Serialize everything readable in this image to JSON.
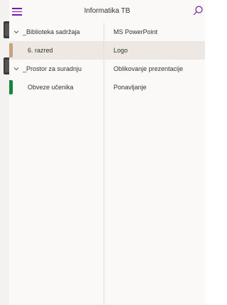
{
  "header": {
    "title": "Informatika TB",
    "menu_icon": "hamburger-icon",
    "search_icon": "search-icon"
  },
  "sections": {
    "groups": [
      {
        "label": "_Biblioteka sadržaja",
        "expanded": true,
        "items": [
          {
            "label": "6. razred",
            "color": "#c8a27a",
            "selected": true
          }
        ]
      },
      {
        "label": "_Prostor za suradnju",
        "expanded": true,
        "items": [
          {
            "label": "Obveze učenika",
            "color": "#0f8a3c",
            "selected": false
          }
        ]
      }
    ]
  },
  "pages": {
    "items": [
      {
        "label": "MS PowerPoint",
        "selected": false
      },
      {
        "label": "Logo",
        "selected": true
      },
      {
        "label": "Oblikovanje prezentacije",
        "selected": false
      },
      {
        "label": "Ponavljanje",
        "selected": false
      }
    ]
  },
  "colors": {
    "accent": "#7719aa",
    "selected_row": "#ede8e3",
    "panel_bg": "#faf9f8"
  }
}
